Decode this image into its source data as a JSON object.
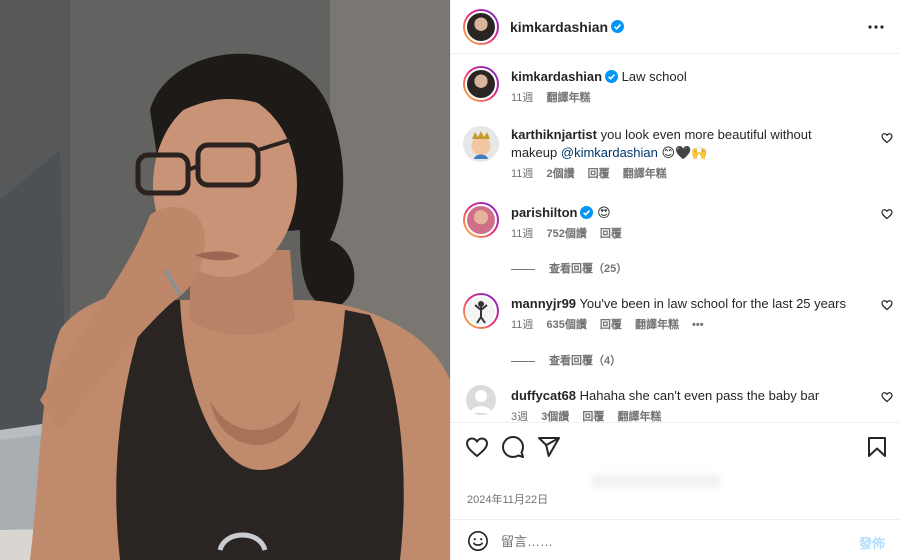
{
  "post": {
    "author": "kimkardashian",
    "caption": "Law school",
    "caption_time": "11週",
    "caption_translate": "翻譯年糕",
    "date": "2024年11月22日"
  },
  "comments": [
    {
      "username": "karthiknjartist",
      "text": "you look even more beautiful without makeup ",
      "mention": "@kimkardashian",
      "emoji": " 😊🖤🙌",
      "time": "11週",
      "likes": "2個讚",
      "reply": "回覆",
      "translate": "翻譯年糕"
    },
    {
      "username": "parishilton",
      "text": "😍",
      "time": "11週",
      "likes": "752個讚",
      "reply": "回覆",
      "view_replies": "查看回覆（25）"
    },
    {
      "username": "mannyjr99",
      "text": "You've been in law school for the last 25 years",
      "time": "11週",
      "likes": "635個讚",
      "reply": "回覆",
      "translate": "翻譯年糕",
      "more": "•••",
      "view_replies": "查看回覆（4）"
    },
    {
      "username": "duffycat68",
      "text": "Hahaha she can't even pass the baby bar",
      "time": "3週",
      "likes": "3個讚",
      "reply": "回覆",
      "translate": "翻譯年糕"
    }
  ],
  "compose": {
    "placeholder": "留言……",
    "post_label": "發佈"
  },
  "icons": {
    "verified": "verified-badge-icon",
    "more": "more-options-icon",
    "like": "heart-icon",
    "comment": "comment-icon",
    "share": "share-icon",
    "save": "bookmark-icon",
    "emoji": "emoji-icon"
  },
  "colors": {
    "verified": "#0095f6",
    "link": "#00376b",
    "post_disabled": "#b2dffc"
  }
}
